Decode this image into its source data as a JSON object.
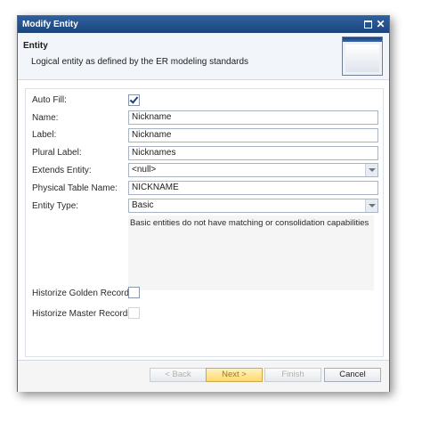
{
  "window": {
    "title": "Modify Entity"
  },
  "header": {
    "title": "Entity",
    "subtitle": "Logical entity as defined by the ER modeling standards"
  },
  "form": {
    "auto_fill": {
      "label": "Auto Fill:",
      "checked": true
    },
    "name": {
      "label": "Name:",
      "value": "Nickname"
    },
    "label": {
      "label": "Label:",
      "value": "Nickname"
    },
    "plural_label": {
      "label": "Plural Label:",
      "value": "Nicknames"
    },
    "extends_entity": {
      "label": "Extends Entity:",
      "value": "<null>"
    },
    "physical_table_name": {
      "label": "Physical Table Name:",
      "value": "NICKNAME"
    },
    "entity_type": {
      "label": "Entity Type:",
      "value": "Basic"
    },
    "entity_type_description": "Basic entities do not have matching or consolidation capabilities",
    "historize_golden": {
      "label": "Historize Golden Records:",
      "checked": false
    },
    "historize_master": {
      "label": "Historize Master Records:",
      "checked": false,
      "disabled": true
    }
  },
  "buttons": {
    "back": "< Back",
    "next": "Next >",
    "finish": "Finish",
    "cancel": "Cancel"
  },
  "colors": {
    "titlebar": "#1b467e",
    "primary_button": "#ffd96b"
  },
  "icons": {
    "restore": "restore-window-icon",
    "close": "close-icon",
    "wizard": "wizard-window-icon"
  }
}
